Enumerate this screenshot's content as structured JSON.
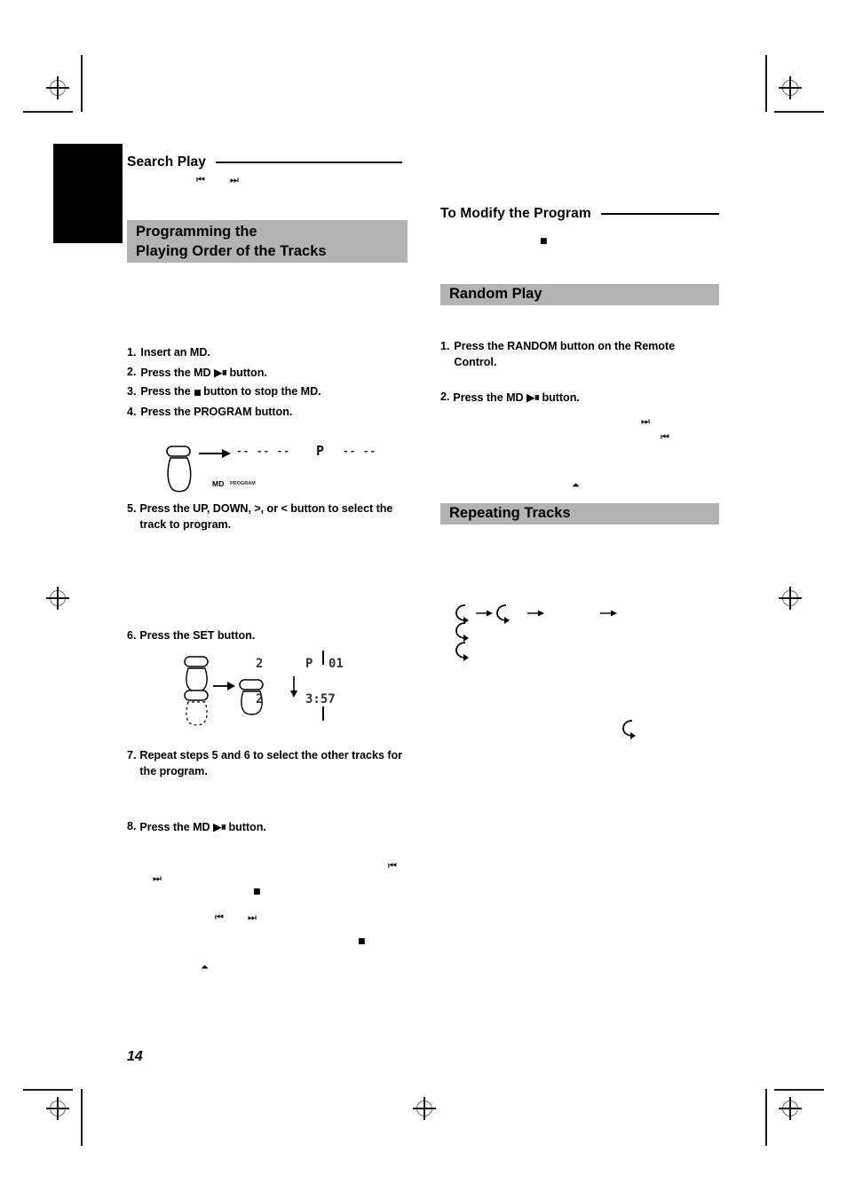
{
  "page": {
    "number": "14",
    "accent_band_color": "#b3b3b3",
    "ink_color": "#000000"
  },
  "left_column": {
    "search_play": {
      "heading": "Search Play",
      "symbols": [
        "rewind-icon",
        "fast-forward-icon"
      ]
    },
    "program_band": {
      "line1": "Programming the",
      "line2": "Playing Order of the Tracks"
    },
    "steps": [
      {
        "num": "1.",
        "text": "Insert an MD."
      },
      {
        "num": "2.",
        "text_before": "Press the MD ",
        "glyph": "▶⏸",
        "text_after": " button."
      },
      {
        "num": "3.",
        "text_before": "Press the ",
        "glyph": "■",
        "text_after": " button to stop the MD."
      },
      {
        "num": "4.",
        "text": "Press the PROGRAM button."
      },
      {
        "num": "5.",
        "text": "Press the UP, DOWN, >, or < button to select the track to program."
      },
      {
        "num": "6.",
        "text": "Press the SET button."
      },
      {
        "num": "7.",
        "text": "Repeat steps 5 and 6 to select the other tracks for the program."
      },
      {
        "num": "8.",
        "text_before": "Press the MD ",
        "glyph": "▶⏸",
        "text_after": " button."
      }
    ],
    "display_1": {
      "caption_md": "MD",
      "caption_program": "PROGRAM",
      "segment_left": "-- -- --",
      "segment_p": "P",
      "segment_right": "-- --"
    },
    "display_2": {
      "row1_track": "2",
      "row1_program": "P",
      "row1_number": "01",
      "row2_track": "2",
      "row2_time": "3:57"
    },
    "floating_symbols": [
      "fast-forward-icon",
      "rewind-icon",
      "stop-icon",
      "rewind-icon",
      "fast-forward-icon",
      "stop-icon",
      "eject-icon"
    ]
  },
  "right_column": {
    "modify_program": {
      "heading": "To Modify the Program",
      "symbol": "stop-icon"
    },
    "random_band": {
      "title": "Random Play"
    },
    "random_steps": [
      {
        "num": "1.",
        "text": "Press the RANDOM button on the Remote Control."
      },
      {
        "num": "2.",
        "text_before": "Press the MD ",
        "glyph": "▶⏸",
        "text_after": " button."
      }
    ],
    "random_symbols": [
      "fast-forward-icon",
      "rewind-icon",
      "eject-icon"
    ],
    "repeating_band": {
      "title": "Repeating Tracks"
    },
    "repeat_sequence": {
      "items": [
        "repeat-one-icon",
        "repeat-all-icon",
        "repeat-off-icon"
      ],
      "arrows": [
        "→",
        "→",
        "→"
      ],
      "stack": [
        "repeat-icon",
        "repeat-icon"
      ],
      "lone": "repeat-icon"
    }
  }
}
